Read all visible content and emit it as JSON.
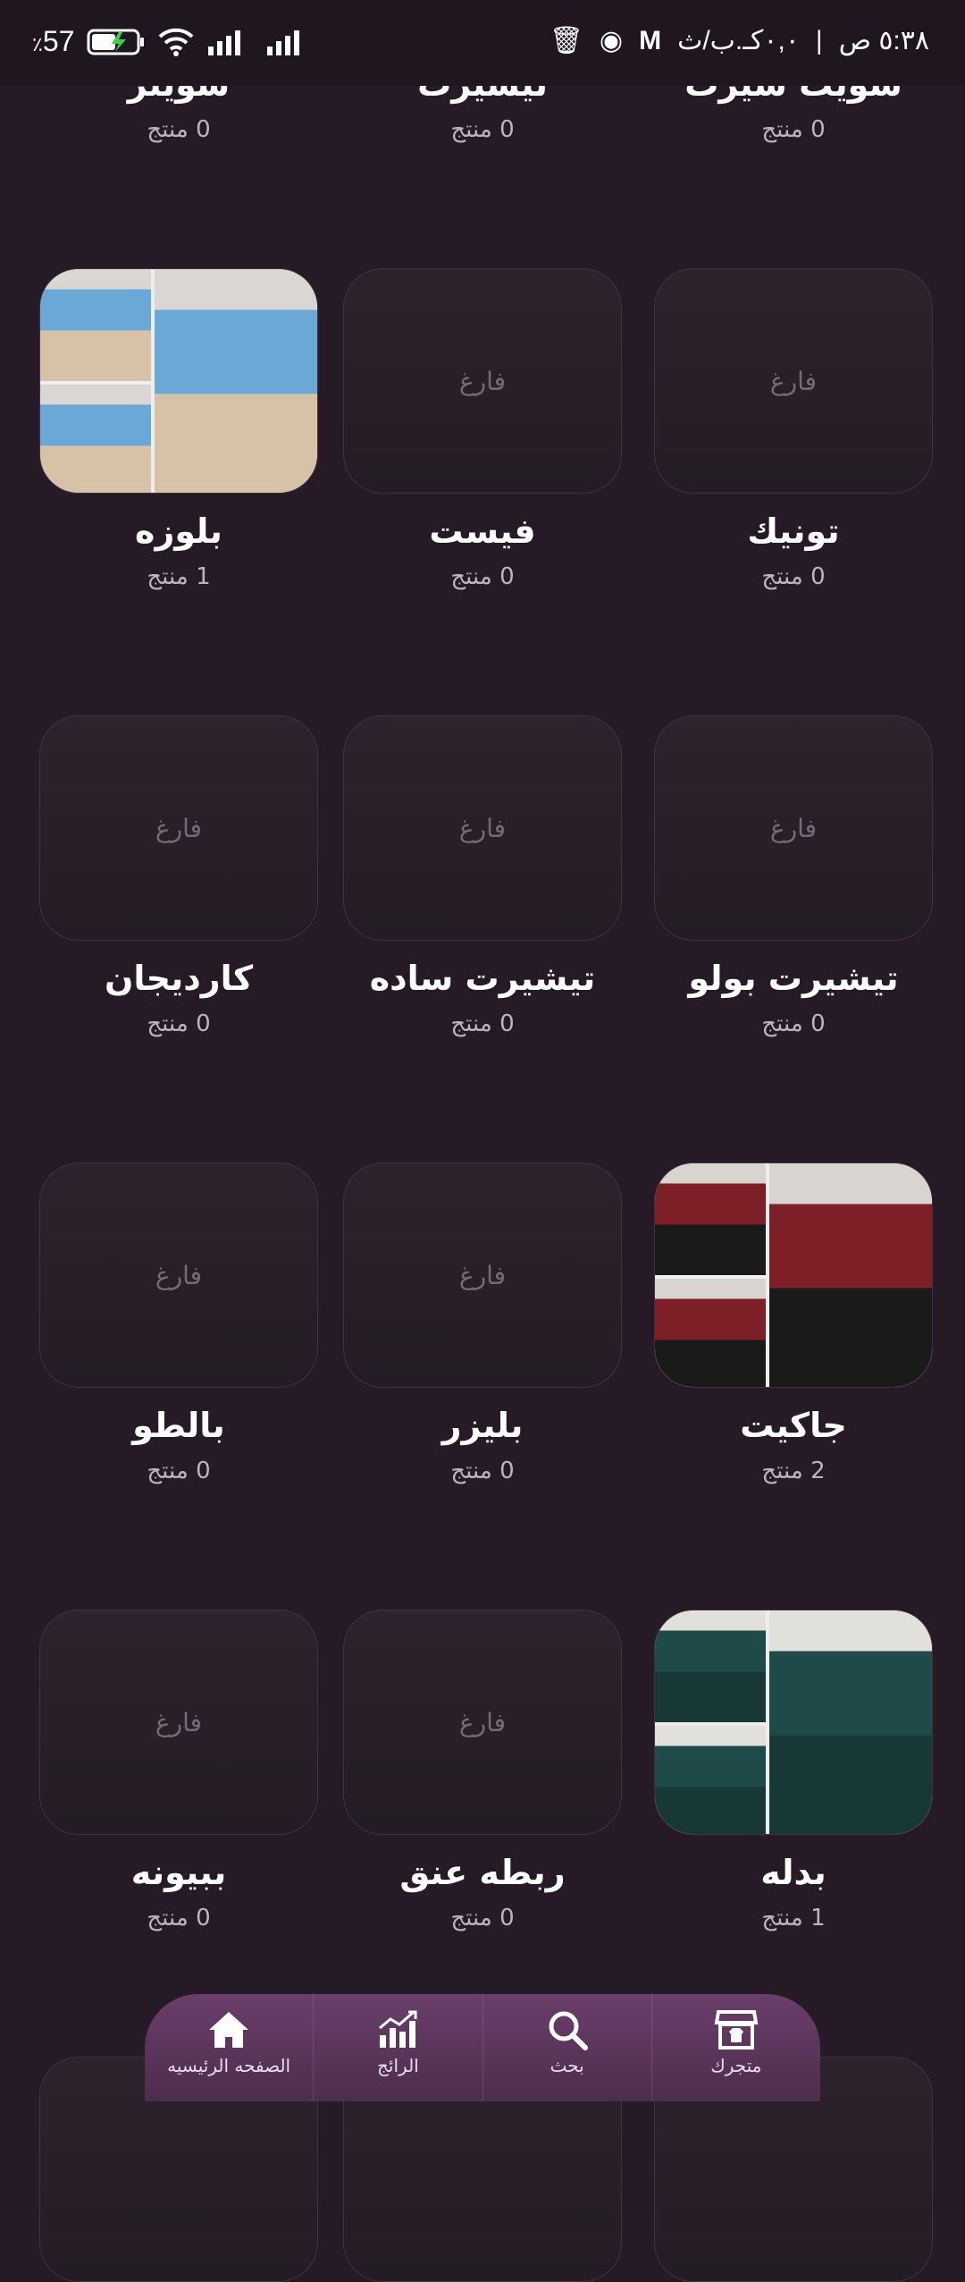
{
  "status_bar": {
    "battery": "57",
    "battery_unit": "٪",
    "time": "٥:٣٨ ص",
    "speed": "٠,٠كـ.ب/ث"
  },
  "categories": [
    {
      "name": "سويت شيرت",
      "count": "0 منتج",
      "empty": true
    },
    {
      "name": "تيشيرت",
      "count": "0 منتج",
      "empty": true
    },
    {
      "name": "سويتر",
      "count": "0 منتج",
      "empty": true
    },
    {
      "name": "تونيك",
      "count": "0 منتج",
      "empty": true
    },
    {
      "name": "فيست",
      "count": "0 منتج",
      "empty": true
    },
    {
      "name": "بلوزه",
      "count": "1 منتج",
      "empty": false
    },
    {
      "name": "تيشيرت بولو",
      "count": "0 منتج",
      "empty": true
    },
    {
      "name": "تيشيرت ساده",
      "count": "0 منتج",
      "empty": true
    },
    {
      "name": "كارديجان",
      "count": "0 منتج",
      "empty": true
    },
    {
      "name": "جاكيت",
      "count": "2 منتج",
      "empty": false
    },
    {
      "name": "بليزر",
      "count": "0 منتج",
      "empty": true
    },
    {
      "name": "بالطو",
      "count": "0 منتج",
      "empty": true
    },
    {
      "name": "بدله",
      "count": "1 منتج",
      "empty": false
    },
    {
      "name": "ربطه عنق",
      "count": "0 منتج",
      "empty": true
    },
    {
      "name": "ببيونه",
      "count": "0 منتج",
      "empty": true
    }
  ],
  "empty_label": "فارغ",
  "bottom_nav": [
    {
      "label": "الصفحه الرئيسيه",
      "icon": "home-icon"
    },
    {
      "label": "الرائج",
      "icon": "chart-icon"
    },
    {
      "label": "بحث",
      "icon": "search-icon"
    },
    {
      "label": "متجرك",
      "icon": "store-icon"
    }
  ]
}
